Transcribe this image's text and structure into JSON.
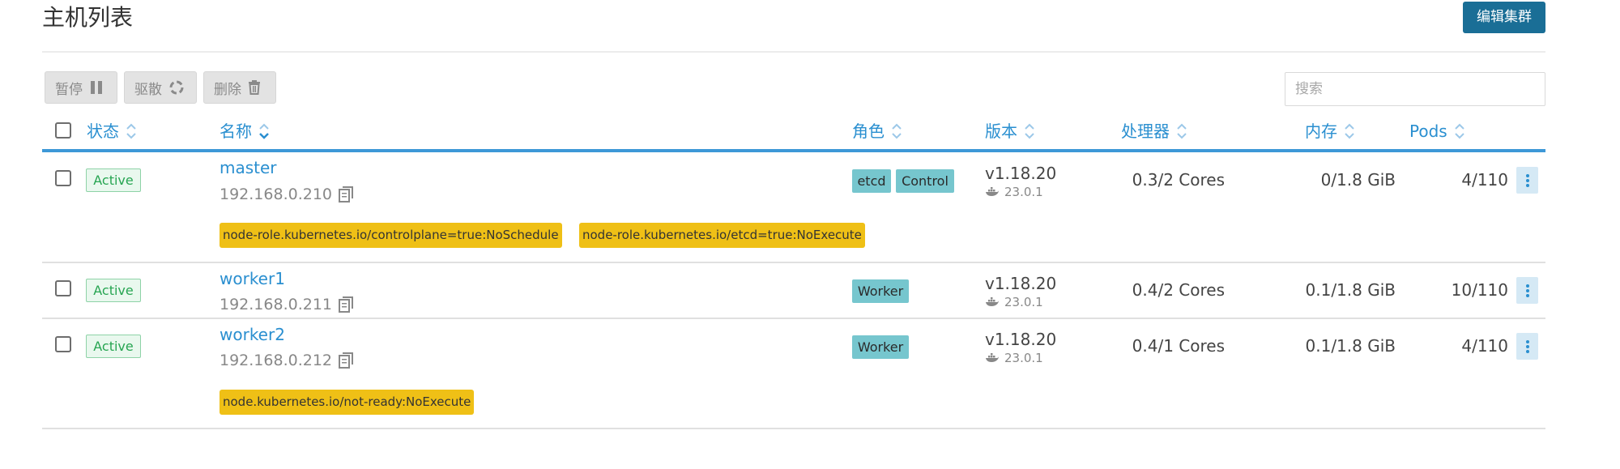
{
  "page": {
    "title": "主机列表"
  },
  "toolbar": {
    "edit_cluster_label": "编辑集群",
    "pause_label": "暂停",
    "drain_label": "驱散",
    "delete_label": "删除",
    "search_placeholder": "搜索",
    "pause_icon": "pause-icon",
    "drain_icon": "refresh-icon",
    "delete_icon": "trash-icon"
  },
  "table": {
    "headers": {
      "state": "状态",
      "name": "名称",
      "roles": "角色",
      "version": "版本",
      "cpu": "处理器",
      "memory": "内存",
      "pods": "Pods"
    },
    "rows": [
      {
        "status": "Active",
        "name": "master",
        "ip": "192.168.0.210",
        "roles": [
          "etcd",
          "Control"
        ],
        "version": "v1.18.20",
        "docker": "23.0.1",
        "cpu": "0.3/2 Cores",
        "memory": "0/1.8 GiB",
        "pods": "4/110",
        "taints": [
          "node-role.kubernetes.io/controlplane=true:NoSchedule",
          "node-role.kubernetes.io/etcd=true:NoExecute"
        ]
      },
      {
        "status": "Active",
        "name": "worker1",
        "ip": "192.168.0.211",
        "roles": [
          "Worker"
        ],
        "version": "v1.18.20",
        "docker": "23.0.1",
        "cpu": "0.4/2 Cores",
        "memory": "0.1/1.8 GiB",
        "pods": "10/110",
        "taints": []
      },
      {
        "status": "Active",
        "name": "worker2",
        "ip": "192.168.0.212",
        "roles": [
          "Worker"
        ],
        "version": "v1.18.20",
        "docker": "23.0.1",
        "cpu": "0.4/1 Cores",
        "memory": "0.1/1.8 GiB",
        "pods": "4/110",
        "taints": [
          "node.kubernetes.io/not-ready:NoExecute"
        ]
      }
    ]
  },
  "colors": {
    "primary": "#2a8fd0",
    "button_dark": "#1a6e96",
    "active_green": "#27a552",
    "role_teal": "#76c6ce",
    "taint_yellow": "#efc016"
  }
}
